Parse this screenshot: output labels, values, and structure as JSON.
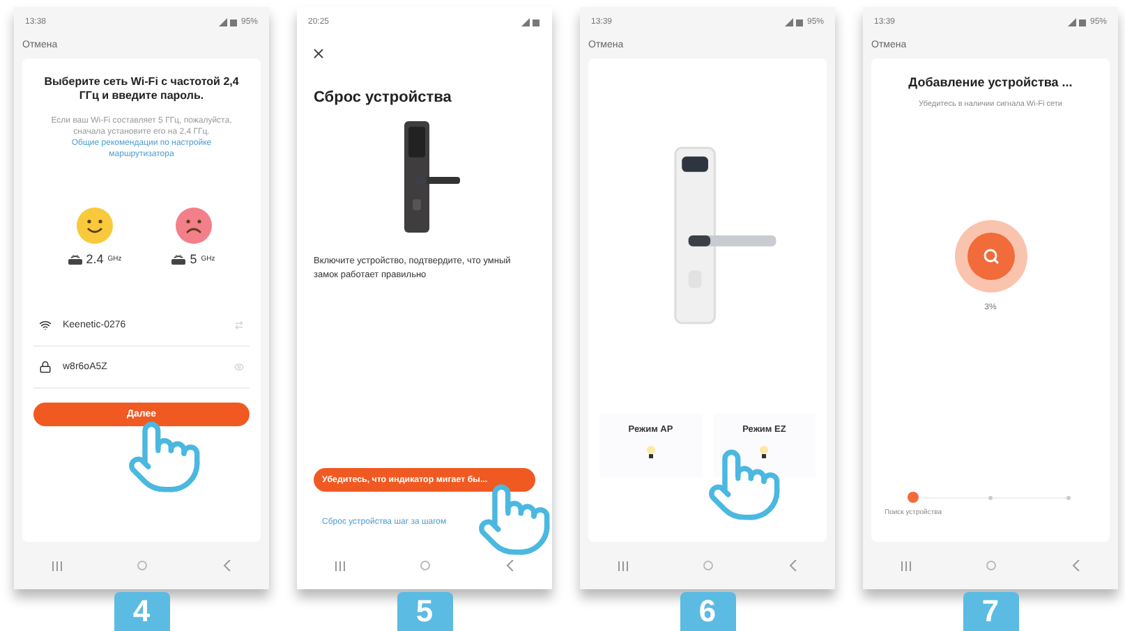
{
  "screens": [
    {
      "kind": "wifi",
      "step": "4",
      "status": {
        "time": "13:38",
        "battery": "95%"
      },
      "cancel": "Отмена",
      "title": "Выберите сеть Wi-Fi с частотой 2,4 ГГц и введите пароль.",
      "note": "Если ваш Wi-Fi составляет 5 ГГц, пожалуйста, сначала установите его на 2,4 ГГц.",
      "note_link": "Общие рекомендации по настройке маршрутизатора",
      "bands": [
        {
          "label": "2.4",
          "unit": "GHz",
          "ok": true
        },
        {
          "label": "5",
          "unit": "GHz",
          "ok": false
        }
      ],
      "ssid": "Keenetic-0276",
      "password": "w8r6oA5Z",
      "button": "Далее"
    },
    {
      "kind": "reset",
      "step": "5",
      "status": {
        "time": "20:25"
      },
      "title": "Сброс устройства",
      "text": "Включите устройство, подтвердите, что умный замок работает правильно",
      "button": "Убедитесь, что индикатор мигает бы...",
      "link": "Сброс устройства шаг за шагом"
    },
    {
      "kind": "mode",
      "step": "6",
      "status": {
        "time": "13:39",
        "battery": "95%"
      },
      "cancel": "Отмена",
      "modes": [
        {
          "label": "Режим AP"
        },
        {
          "label": "Режим EZ"
        }
      ]
    },
    {
      "kind": "adding",
      "step": "7",
      "status": {
        "time": "13:39",
        "battery": "95%"
      },
      "cancel": "Отмена",
      "title": "Добавление устройства ...",
      "subtitle": "Убедитесь в наличии сигнала Wi-Fi сети",
      "progress": "3%",
      "steps": [
        {
          "label": "Поиск устройства",
          "done": true
        },
        {
          "done": false
        },
        {
          "done": false
        }
      ]
    }
  ]
}
